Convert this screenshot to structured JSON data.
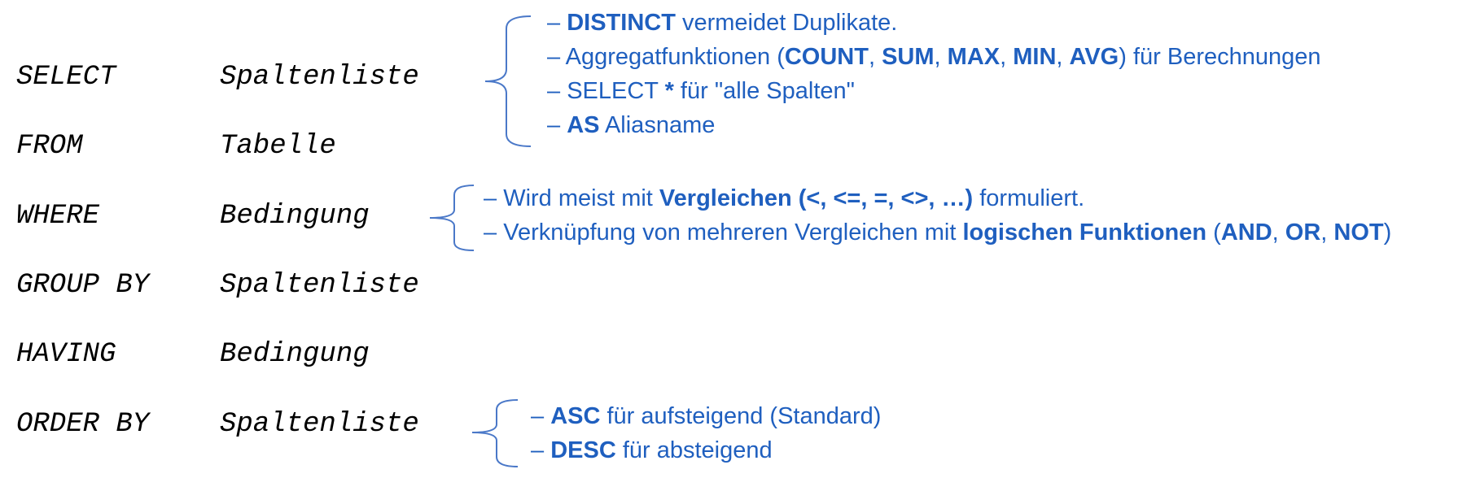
{
  "colors": {
    "accent": "#1f5fbf",
    "text": "#000000",
    "brace": "#4a78c8"
  },
  "clauses": [
    {
      "keyword": "SELECT",
      "arg": "Spaltenliste"
    },
    {
      "keyword": "FROM",
      "arg": "Tabelle"
    },
    {
      "keyword": "WHERE",
      "arg": "Bedingung"
    },
    {
      "keyword": "GROUP BY",
      "arg": "Spaltenliste"
    },
    {
      "keyword": "HAVING",
      "arg": "Bedingung"
    },
    {
      "keyword": "ORDER BY",
      "arg": "Spaltenliste"
    }
  ],
  "notes": {
    "select": [
      {
        "dash": "–",
        "b1": "DISTINCT",
        "t1": " vermeidet Duplikate."
      },
      {
        "dash": "–",
        "t1": "Aggregatfunktionen (",
        "b1": "COUNT",
        "s1": ", ",
        "b2": "SUM",
        "s2": ", ",
        "b3": "MAX",
        "s3": ", ",
        "b4": "MIN",
        "s4": ", ",
        "b5": "AVG",
        "t2": ") für Berechnungen"
      },
      {
        "dash": "–",
        "t1": "SELECT ",
        "b1": "*",
        "t2": " für \"alle Spalten\""
      },
      {
        "dash": "–",
        "b1": "AS",
        "t1": " Aliasname"
      }
    ],
    "where": [
      {
        "dash": "–",
        "t1": "Wird meist mit ",
        "b1": "Vergleichen (<, <=, =, <>, …)",
        "t2": " formuliert."
      },
      {
        "dash": "–",
        "t1": "Verknüpfung von mehreren Vergleichen mit ",
        "b1": "logischen Funktionen",
        "t2": " (",
        "b2": "AND",
        "s1": ", ",
        "b3": "OR",
        "s2": ", ",
        "b4": "NOT",
        "t3": ")"
      }
    ],
    "order": [
      {
        "dash": "–",
        "b1": "ASC",
        "t1": " für aufsteigend (Standard)"
      },
      {
        "dash": "–",
        "b1": "DESC",
        "t1": " für absteigend"
      }
    ]
  }
}
